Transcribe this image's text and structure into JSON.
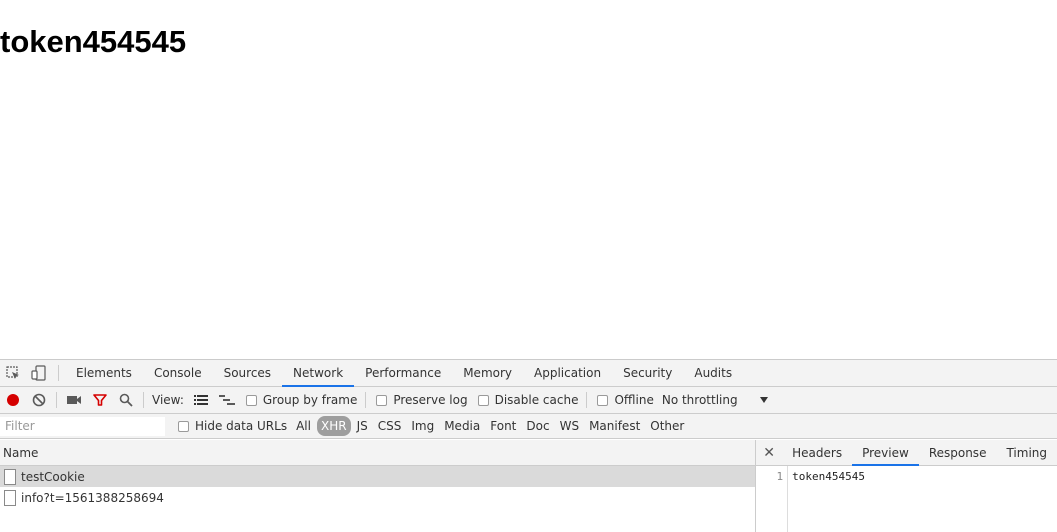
{
  "page": {
    "heading": "token454545"
  },
  "devtools": {
    "tabs": [
      "Elements",
      "Console",
      "Sources",
      "Network",
      "Performance",
      "Memory",
      "Application",
      "Security",
      "Audits"
    ],
    "active_tab": "Network",
    "toolbar": {
      "view_label": "View:",
      "group_by_frame": "Group by frame",
      "preserve_log": "Preserve log",
      "disable_cache": "Disable cache",
      "offline": "Offline",
      "throttling": "No throttling"
    },
    "filter": {
      "placeholder": "Filter",
      "hide_data_urls": "Hide data URLs",
      "types": [
        "All",
        "XHR",
        "JS",
        "CSS",
        "Img",
        "Media",
        "Font",
        "Doc",
        "WS",
        "Manifest",
        "Other"
      ],
      "active_type": "XHR"
    },
    "requests": {
      "header": "Name",
      "rows": [
        {
          "name": "testCookie",
          "selected": true
        },
        {
          "name": "info?t=1561388258694",
          "selected": false
        }
      ]
    },
    "detail": {
      "tabs": [
        "Headers",
        "Preview",
        "Response",
        "Timing"
      ],
      "active_tab": "Preview",
      "line_number": "1",
      "content": "token454545"
    }
  },
  "colors": {
    "accent": "#1a73e8",
    "record": "#d50000",
    "filter_icon": "#d50000"
  }
}
